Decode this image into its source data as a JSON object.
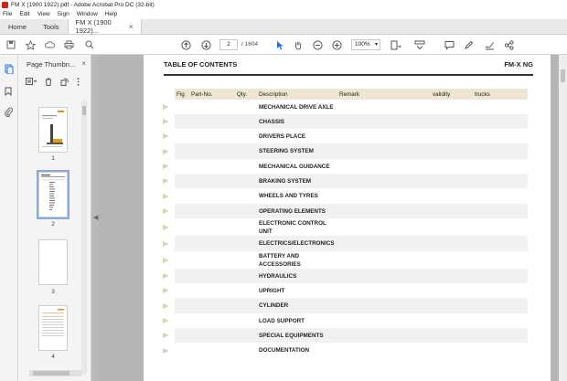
{
  "window": {
    "title": "FM X (1900 1922).pdf - Adobe Acrobat Pro DC (32-bit)"
  },
  "menu": [
    "File",
    "Edit",
    "View",
    "Sign",
    "Window",
    "Help"
  ],
  "tabs": {
    "home": "Home",
    "tools": "Tools",
    "doc": "FM X (1900 1922)...",
    "close": "×"
  },
  "toolbar": {
    "page_current": "2",
    "page_total": "/ 1604",
    "zoom": "100%"
  },
  "thumbnails": {
    "title": "Page Thumbn...",
    "close": "×",
    "pages": [
      "1",
      "2",
      "3",
      "4"
    ],
    "selected": "2"
  },
  "document": {
    "title": "TABLE OF CONTENTS",
    "model": "FM-X NG",
    "columns": [
      "Fig",
      "Part-No.",
      "Qty.",
      "Description",
      "Remark",
      "validity",
      "trucks"
    ],
    "rows": [
      "MECHANICAL DRIVE AXLE",
      "CHASSIS",
      "DRIVERS PLACE",
      "STEERING SYSTEM",
      "MECHANICAL GUIDANCE",
      "BRAKING SYSTEM",
      "WHEELS AND TYRES",
      "OPERATING ELEMENTS",
      "ELECTRONIC CONTROL UNIT",
      "ELECTRICS/ELECTRONICS",
      "BATTERY AND ACCESSORIES",
      "HYDRAULICS",
      "UPRIGHT",
      "CYLINDER",
      "LOAD SUPPORT",
      "SPECIAL EQUIPMENTS",
      "DOCUMENTATION"
    ]
  },
  "colors": {
    "header_band": "#efe5d3",
    "arrow": "#ded1b4",
    "selection": "#8aa9d6"
  }
}
